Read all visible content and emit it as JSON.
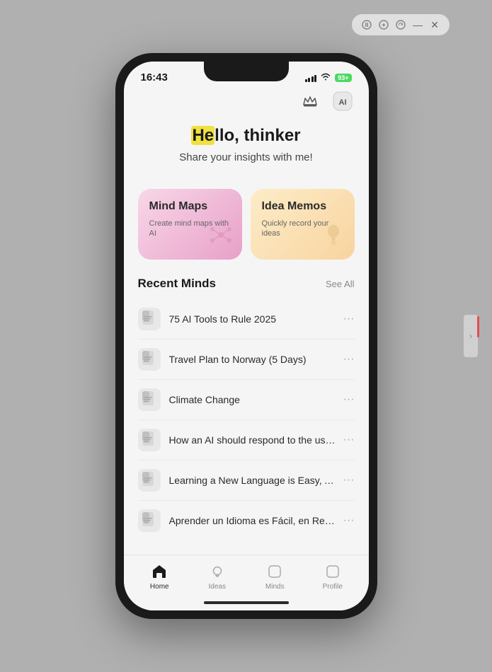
{
  "window": {
    "controls": [
      "pause",
      "star",
      "refresh",
      "minimize",
      "close"
    ]
  },
  "status_bar": {
    "time": "16:43",
    "battery": "93+"
  },
  "top_actions": {
    "crown_icon": "👑",
    "ai_icon": "AI"
  },
  "hero": {
    "greeting_prefix": "",
    "greeting_highlight": "He",
    "greeting_rest": "llo, thinker",
    "subtitle": "Share your insights with me!"
  },
  "cards": [
    {
      "id": "mind-maps",
      "title": "Mind Maps",
      "subtitle": "Create mind maps with AI",
      "icon": "✦"
    },
    {
      "id": "idea-memos",
      "title": "Idea Memos",
      "subtitle": "Quickly record your ideas",
      "icon": "💡"
    }
  ],
  "recent_section": {
    "title": "Recent Minds",
    "see_all": "See All"
  },
  "recent_items": [
    {
      "id": 1,
      "name": "75 AI Tools to Rule 2025"
    },
    {
      "id": 2,
      "name": "Travel Plan to Norway (5 Days)"
    },
    {
      "id": 3,
      "name": "Climate Change"
    },
    {
      "id": 4,
      "name": "How an AI should respond to the users..."
    },
    {
      "id": 5,
      "name": "Learning a New Language is Easy, Act..."
    },
    {
      "id": 6,
      "name": "Aprender un Idioma es Fácil, en Realid..."
    }
  ],
  "bottom_nav": [
    {
      "id": "home",
      "label": "Home",
      "active": true
    },
    {
      "id": "ideas",
      "label": "Ideas",
      "active": false
    },
    {
      "id": "minds",
      "label": "Minds",
      "active": false
    },
    {
      "id": "profile",
      "label": "Profile",
      "active": false
    }
  ]
}
